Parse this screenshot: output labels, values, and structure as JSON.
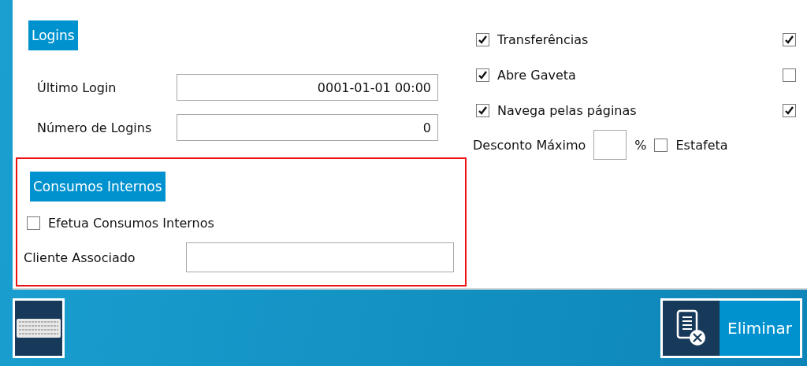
{
  "logins": {
    "heading": "Logins",
    "fields": [
      {
        "label": "Último Login",
        "value": "0001-01-01 00:00"
      },
      {
        "label": "Número de Logins",
        "value": "0"
      }
    ]
  },
  "internal_consumption": {
    "heading": "Consumos Internos",
    "highlighted": true,
    "option": {
      "label": "Efetua Consumos Internos",
      "checked": false
    },
    "field": {
      "label": "Cliente Associado"
    }
  },
  "permissions": [
    {
      "label": "Transferências",
      "checked": true,
      "second_checked": true
    },
    {
      "label": "Abre Gaveta",
      "checked": true,
      "second_checked": false
    },
    {
      "label": "Navega pelas páginas",
      "checked": true,
      "second_checked": true
    }
  ],
  "discount": {
    "label": "Desconto Máximo",
    "unit": "%",
    "courier": {
      "label": "Estafeta",
      "checked": false
    }
  },
  "footer": {
    "delete_button": "Eliminar"
  }
}
